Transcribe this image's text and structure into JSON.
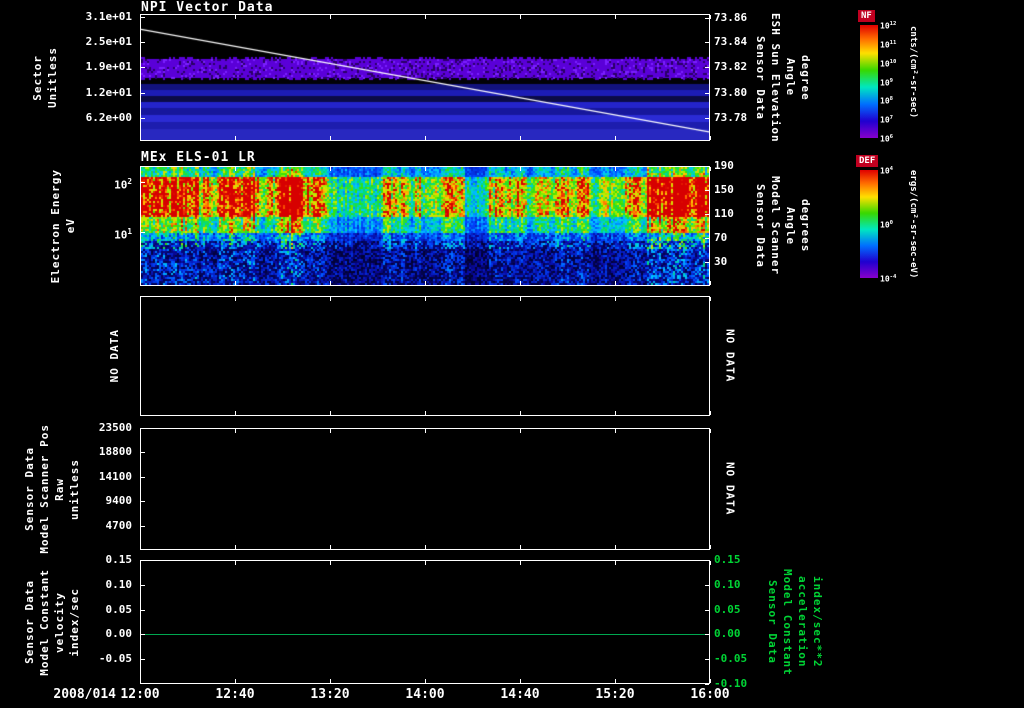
{
  "colors": {
    "background": "#000000",
    "foreground": "#ffffff",
    "green_line": "#00a850",
    "green_text": "#00d435",
    "colorbar_badge_bg": "#c00020"
  },
  "xaxis": {
    "date": "2008/014",
    "ticks": [
      "12:00",
      "12:40",
      "13:20",
      "14:00",
      "14:40",
      "15:20",
      "16:00"
    ]
  },
  "panels": {
    "p1": {
      "title": "NPI Vector Data",
      "left_title_lines": [
        "Sector",
        "Unitless"
      ],
      "right_title_lines": [
        "Sensor Data",
        "ESH Sun Elevation",
        "Angle",
        "degree"
      ]
    },
    "p2": {
      "title": "MEx ELS-01 LR",
      "left_title_lines": [
        "Electron Energy",
        "eV"
      ],
      "right_title_lines": [
        "Sensor Data",
        "Model Scanner",
        "Angle",
        "degrees"
      ]
    },
    "p3": {
      "left_no_data": "NO DATA",
      "right_no_data": "NO DATA"
    },
    "p4": {
      "left_title_lines": [
        "Sensor Data",
        "Model Scanner Pos",
        "Raw",
        "unitless"
      ],
      "right_no_data": "NO DATA"
    },
    "p5": {
      "left_title_lines": [
        "Sensor Data",
        "Model Constant",
        "velocity",
        "index/sec"
      ],
      "right_title_lines": [
        "Sensor Data",
        "Model Constant",
        "acceleration",
        "index/sec**2"
      ]
    }
  },
  "colorbars": [
    {
      "name": "NF",
      "unit": "cnts/(cm²-sr-sec)",
      "ticks": [
        "10^12",
        "10^11",
        "10^10",
        "10^9",
        "10^8",
        "10^7",
        "10^6"
      ]
    },
    {
      "name": "DEF",
      "unit": "ergs/(cm²-sr-sec-eV)",
      "ticks": [
        "10^4",
        "10^0",
        "10^-4"
      ]
    }
  ],
  "chart_data": [
    {
      "panel": "p1",
      "type": "heatmap",
      "title": "NPI Vector Data",
      "ylabel": "Sector (Unitless)",
      "xlabel": "time, 2008/014 12:00-16:00",
      "left_ticks": {
        "labels": [
          "3.1e+01",
          "2.5e+01",
          "1.9e+01",
          "1.2e+01",
          "6.2e+00"
        ],
        "fracs": [
          0.02,
          0.22,
          0.42,
          0.62,
          0.82
        ]
      },
      "right_ticks": {
        "labels": [
          "73.86",
          "73.84",
          "73.82",
          "73.80",
          "73.78"
        ],
        "fracs": [
          0.03,
          0.22,
          0.42,
          0.62,
          0.82
        ]
      },
      "bands": [
        {
          "y0": 0.0,
          "y1": 0.35,
          "color": "#000000"
        },
        {
          "y0": 0.35,
          "y1": 0.5,
          "color": "#5a00d8",
          "noise": true
        },
        {
          "y0": 0.5,
          "y1": 0.555,
          "color": "#020208"
        },
        {
          "y0": 0.555,
          "y1": 0.6,
          "color": "#12127e"
        },
        {
          "y0": 0.6,
          "y1": 0.645,
          "color": "#1c1cb6"
        },
        {
          "y0": 0.645,
          "y1": 0.695,
          "color": "#0b0b48"
        },
        {
          "y0": 0.695,
          "y1": 0.745,
          "color": "#2424ca"
        },
        {
          "y0": 0.745,
          "y1": 0.8,
          "color": "#17179c"
        },
        {
          "y0": 0.8,
          "y1": 0.855,
          "color": "#2b2bd4"
        },
        {
          "y0": 0.855,
          "y1": 0.91,
          "color": "#1d1dae"
        },
        {
          "y0": 0.91,
          "y1": 1.0,
          "color": "#2828c0"
        }
      ],
      "overlay_line": {
        "name": "ESH Sun Elevation Angle (degree)",
        "color": "#ffffff",
        "start_value": 73.855,
        "end_value": 73.776,
        "y0_frac": 0.115,
        "y1_frac": 0.935
      }
    },
    {
      "panel": "p2",
      "type": "heatmap",
      "title": "MEx ELS-01 LR",
      "ylabel": "Electron Energy (eV)",
      "yscale": "log",
      "left_ticks": {
        "labels": [
          "10^2",
          "10^1"
        ],
        "fracs": [
          0.13,
          0.55
        ]
      },
      "right_ticks": {
        "labels": [
          "190",
          "150",
          "110",
          "70",
          "30"
        ],
        "fracs": [
          0.0,
          0.2,
          0.4,
          0.6,
          0.8
        ]
      },
      "row_profile": [
        [
          0.0,
          0.07,
          0.5
        ],
        [
          0.07,
          0.42,
          0.95
        ],
        [
          0.42,
          0.55,
          0.62
        ],
        [
          0.55,
          0.68,
          0.38
        ],
        [
          0.68,
          1.0,
          0.24
        ]
      ],
      "hot_columns": [
        [
          0.0,
          0.05,
          1.05
        ],
        [
          0.05,
          0.1,
          1.2
        ],
        [
          0.1,
          0.135,
          0.9
        ],
        [
          0.135,
          0.2,
          1.15
        ],
        [
          0.2,
          0.24,
          0.85
        ],
        [
          0.24,
          0.285,
          1.35
        ],
        [
          0.285,
          0.33,
          0.9
        ],
        [
          0.33,
          0.42,
          0.55
        ],
        [
          0.42,
          0.47,
          0.85
        ],
        [
          0.47,
          0.53,
          0.7
        ],
        [
          0.53,
          0.57,
          0.95
        ],
        [
          0.57,
          0.61,
          0.5
        ],
        [
          0.61,
          0.67,
          0.8
        ],
        [
          0.67,
          0.73,
          0.72
        ],
        [
          0.73,
          0.79,
          0.88
        ],
        [
          0.79,
          0.85,
          0.68
        ],
        [
          0.85,
          0.89,
          0.95
        ],
        [
          0.89,
          1.0,
          1.3
        ]
      ],
      "seed": 42
    },
    {
      "panel": "p3",
      "type": "empty",
      "note": "NO DATA"
    },
    {
      "panel": "p4",
      "type": "empty",
      "note": "NO DATA",
      "ylabel": "Sensor Data Model Scanner Pos Raw (unitless)",
      "left_ticks": {
        "labels": [
          "23500",
          "18800",
          "14100",
          "9400",
          "4700"
        ],
        "fracs": [
          0.0,
          0.2,
          0.4,
          0.6,
          0.8
        ]
      }
    },
    {
      "panel": "p5",
      "type": "line",
      "ylabel": "Sensor Data Model Constant velocity (index/sec)",
      "ylim": [
        -0.1,
        0.15
      ],
      "left_ticks": {
        "labels": [
          "0.15",
          "0.10",
          "0.05",
          "0.00",
          "-0.05"
        ],
        "fracs": [
          0.0,
          0.2,
          0.4,
          0.6,
          0.8
        ]
      },
      "right_ticks": {
        "labels": [
          "0.15",
          "0.10",
          "0.05",
          "0.00",
          "-0.05",
          "-0.10"
        ],
        "fracs": [
          0.0,
          0.2,
          0.4,
          0.6,
          0.8,
          1.0
        ],
        "color": "green_text"
      },
      "series": [
        {
          "name": "velocity",
          "constant_value": 0.0,
          "color": "green_line"
        }
      ]
    }
  ]
}
